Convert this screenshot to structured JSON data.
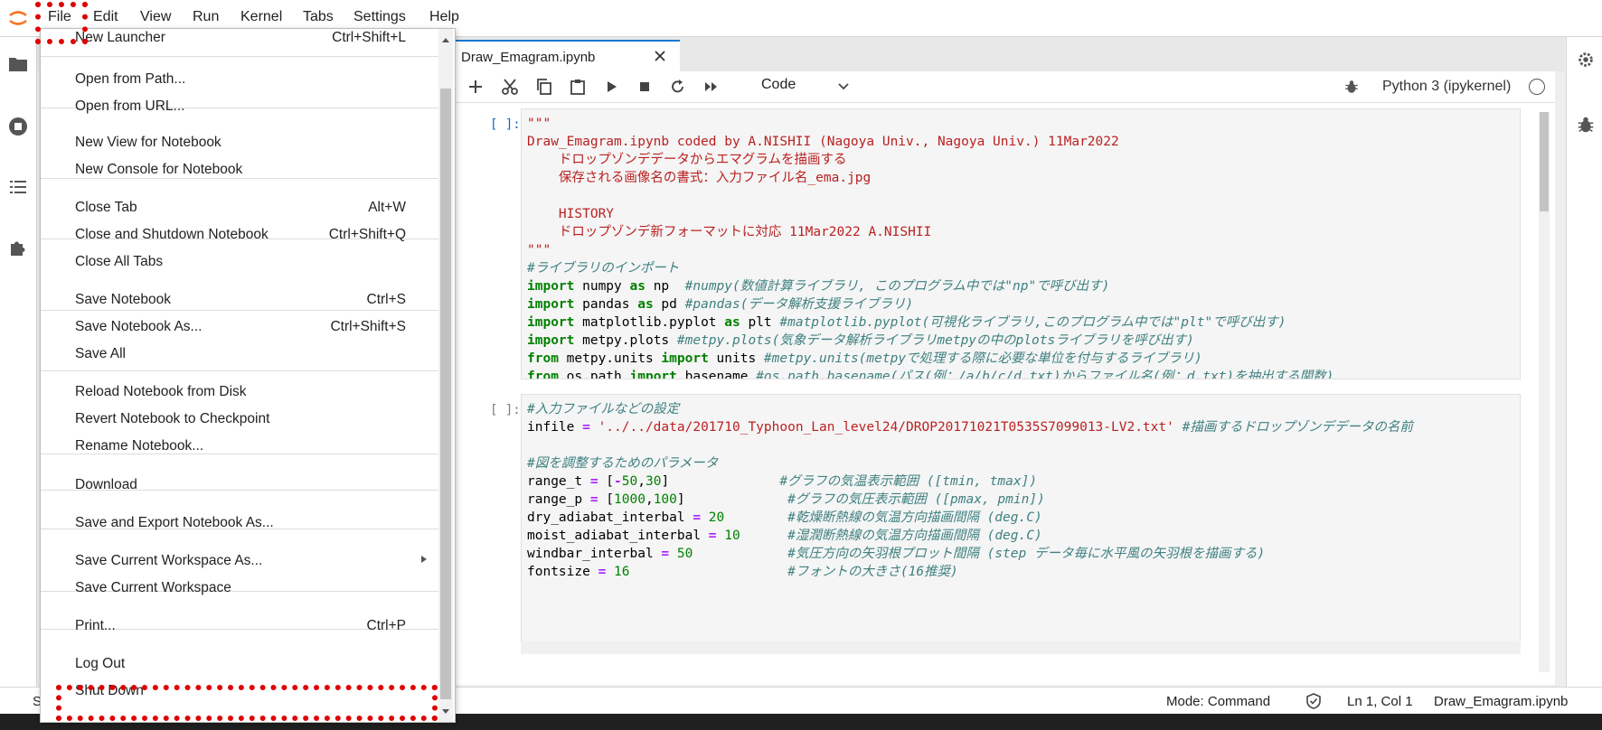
{
  "menubar": {
    "items": [
      "File",
      "Edit",
      "View",
      "Run",
      "Kernel",
      "Tabs",
      "Settings",
      "Help"
    ]
  },
  "tab": {
    "title": "Draw_Emagram.ipynb"
  },
  "toolbar": {
    "cell_type": "Code",
    "kernel": "Python 3 (ipykernel)",
    "icons": [
      "plus-icon",
      "cut-icon",
      "copy-icon",
      "paste-icon",
      "run-icon",
      "stop-icon",
      "restart-icon",
      "fast-forward-icon"
    ]
  },
  "file_menu": {
    "items": [
      {
        "label": "New Launcher",
        "shortcut": "Ctrl+Shift+L"
      },
      {
        "label": "Open from Path...",
        "shortcut": ""
      },
      {
        "label": "Open from URL...",
        "shortcut": ""
      },
      {
        "label": "New View for Notebook",
        "shortcut": ""
      },
      {
        "label": "New Console for Notebook",
        "shortcut": ""
      },
      {
        "label": "Close Tab",
        "shortcut": "Alt+W"
      },
      {
        "label": "Close and Shutdown Notebook",
        "shortcut": "Ctrl+Shift+Q"
      },
      {
        "label": "Close All Tabs",
        "shortcut": ""
      },
      {
        "label": "Save Notebook",
        "shortcut": "Ctrl+S"
      },
      {
        "label": "Save Notebook As...",
        "shortcut": "Ctrl+Shift+S"
      },
      {
        "label": "Save All",
        "shortcut": ""
      },
      {
        "label": "Reload Notebook from Disk",
        "shortcut": ""
      },
      {
        "label": "Revert Notebook to Checkpoint",
        "shortcut": ""
      },
      {
        "label": "Rename Notebook...",
        "shortcut": ""
      },
      {
        "label": "Download",
        "shortcut": ""
      },
      {
        "label": "Save and Export Notebook As...",
        "shortcut": ""
      },
      {
        "label": "Save Current Workspace As...",
        "shortcut": ""
      },
      {
        "label": "Save Current Workspace",
        "shortcut": ""
      },
      {
        "label": "Print...",
        "shortcut": "Ctrl+P"
      },
      {
        "label": "Log Out",
        "shortcut": ""
      },
      {
        "label": "Shut Down",
        "shortcut": ""
      }
    ]
  },
  "cells": [
    {
      "prompt": "[ ]:",
      "lines": [
        [
          [
            "str",
            "\"\"\""
          ]
        ],
        [
          [
            "str",
            "Draw_Emagram.ipynb coded by A.NISHII (Nagoya Univ., Nagoya Univ.) 11Mar2022"
          ]
        ],
        [
          [
            "str",
            "    ドロップゾンデデータからエマグラムを描画する"
          ]
        ],
        [
          [
            "str",
            "    保存される画像名の書式：入力ファイル名_ema.jpg"
          ]
        ],
        [
          [
            "str",
            ""
          ]
        ],
        [
          [
            "str",
            "    HISTORY"
          ]
        ],
        [
          [
            "str",
            "    ドロップゾンデ新フォーマットに対応 11Mar2022 A.NISHII"
          ]
        ],
        [
          [
            "str",
            "\"\"\""
          ]
        ],
        [
          [
            "cmt",
            "#ライブラリのインポート"
          ]
        ],
        [
          [
            "kw",
            "import"
          ],
          [
            "plain",
            " numpy "
          ],
          [
            "kw",
            "as"
          ],
          [
            "plain",
            " np  "
          ],
          [
            "cmt",
            "#numpy(数値計算ライブラリ, このプログラム中では\"np\"で呼び出す)"
          ]
        ],
        [
          [
            "kw",
            "import"
          ],
          [
            "plain",
            " pandas "
          ],
          [
            "kw",
            "as"
          ],
          [
            "plain",
            " pd "
          ],
          [
            "cmt",
            "#pandas(データ解析支援ライブラリ)"
          ]
        ],
        [
          [
            "kw",
            "import"
          ],
          [
            "plain",
            " matplotlib.pyplot "
          ],
          [
            "kw",
            "as"
          ],
          [
            "plain",
            " plt "
          ],
          [
            "cmt",
            "#matplotlib.pyplot(可視化ライブラリ,このプログラム中では\"plt\"で呼び出す)"
          ]
        ],
        [
          [
            "kw",
            "import"
          ],
          [
            "plain",
            " metpy.plots "
          ],
          [
            "cmt",
            "#metpy.plots(気象データ解析ライブラリmetpyの中のplotsライブラリを呼び出す)"
          ]
        ],
        [
          [
            "kw",
            "from"
          ],
          [
            "plain",
            " metpy.units "
          ],
          [
            "kw",
            "import"
          ],
          [
            "plain",
            " units "
          ],
          [
            "cmt",
            "#metpy.units(metpyで処理する際に必要な単位を付与するライブラリ)"
          ]
        ],
        [
          [
            "kw",
            "from"
          ],
          [
            "plain",
            " os.path "
          ],
          [
            "kw",
            "import"
          ],
          [
            "plain",
            " basename "
          ],
          [
            "cmt",
            "#os.path.basename(パス(例：/a/b/c/d.txt)からファイル名(例：d.txt)を抽出する関数)"
          ]
        ]
      ]
    },
    {
      "prompt": "[ ]:",
      "lines": [
        [
          [
            "cmt",
            "#入力ファイルなどの設定"
          ]
        ],
        [
          [
            "plain",
            "infile "
          ],
          [
            "op",
            "="
          ],
          [
            "plain",
            " "
          ],
          [
            "str",
            "'../../data/201710_Typhoon_Lan_level24/DROP20171021T0535S7099013-LV2.txt'"
          ],
          [
            "plain",
            " "
          ],
          [
            "cmt",
            "#描画するドロップゾンデデータの名前"
          ]
        ],
        [
          [
            "plain",
            ""
          ]
        ],
        [
          [
            "cmt",
            "#図を調整するためのパラメータ"
          ]
        ],
        [
          [
            "plain",
            "range_t "
          ],
          [
            "op",
            "="
          ],
          [
            "plain",
            " ["
          ],
          [
            "op",
            "-"
          ],
          [
            "num",
            "50"
          ],
          [
            "plain",
            ","
          ],
          [
            "num",
            "30"
          ],
          [
            "plain",
            "]              "
          ],
          [
            "cmt",
            "#グラフの気温表示範囲 ([tmin, tmax])"
          ]
        ],
        [
          [
            "plain",
            "range_p "
          ],
          [
            "op",
            "="
          ],
          [
            "plain",
            " ["
          ],
          [
            "num",
            "1000"
          ],
          [
            "plain",
            ","
          ],
          [
            "num",
            "100"
          ],
          [
            "plain",
            "]             "
          ],
          [
            "cmt",
            "#グラフの気圧表示範囲 ([pmax, pmin])"
          ]
        ],
        [
          [
            "plain",
            "dry_adiabat_interbal "
          ],
          [
            "op",
            "="
          ],
          [
            "plain",
            " "
          ],
          [
            "num",
            "20"
          ],
          [
            "plain",
            "        "
          ],
          [
            "cmt",
            "#乾燥断熱線の気温方向描画間隔 (deg.C)"
          ]
        ],
        [
          [
            "plain",
            "moist_adiabat_interbal "
          ],
          [
            "op",
            "="
          ],
          [
            "plain",
            " "
          ],
          [
            "num",
            "10"
          ],
          [
            "plain",
            "      "
          ],
          [
            "cmt",
            "#湿潤断熱線の気温方向描画間隔 (deg.C)"
          ]
        ],
        [
          [
            "plain",
            "windbar_interbal "
          ],
          [
            "op",
            "="
          ],
          [
            "plain",
            " "
          ],
          [
            "num",
            "50"
          ],
          [
            "plain",
            "            "
          ],
          [
            "cmt",
            "#気圧方向の矢羽根プロット間隔 (step データ毎に水平風の矢羽根を描画する)"
          ]
        ],
        [
          [
            "plain",
            "fontsize "
          ],
          [
            "op",
            "="
          ],
          [
            "plain",
            " "
          ],
          [
            "num",
            "16"
          ],
          [
            "plain",
            "                    "
          ],
          [
            "cmt",
            "#フォントの大きさ(16推奨)"
          ]
        ]
      ]
    }
  ],
  "status": {
    "left": "S",
    "mode": "Mode: Command",
    "position": "Ln 1, Col 1",
    "file": "Draw_Emagram.ipynb"
  },
  "colors": {
    "accent": "#1976d2",
    "highlight": "#e00000",
    "logo": "#f37726"
  }
}
